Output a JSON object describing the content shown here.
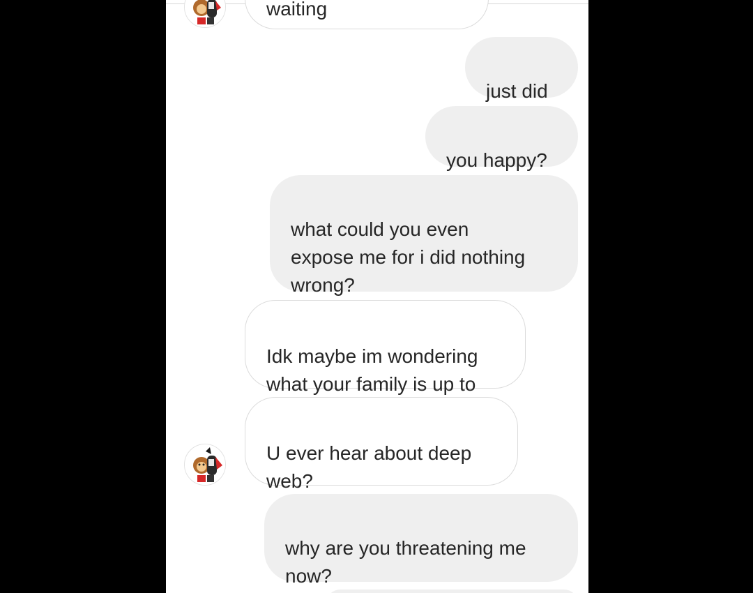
{
  "conversation": {
    "partial_message": "waiting",
    "messages": [
      {
        "side": "out",
        "text": "just did"
      },
      {
        "side": "out",
        "text": "you happy?"
      },
      {
        "side": "out",
        "text": "what could you even\nexpose me for i did nothing\nwrong?"
      },
      {
        "side": "in",
        "text": "Idk maybe im wondering\nwhat your family is up to"
      },
      {
        "side": "in",
        "text": "U ever hear about deep\nweb?"
      },
      {
        "side": "out",
        "text": "why are you threatening me\nnow?"
      }
    ]
  },
  "contact": {
    "avatar_icon": "cartoon-monkey-avatar-icon"
  }
}
